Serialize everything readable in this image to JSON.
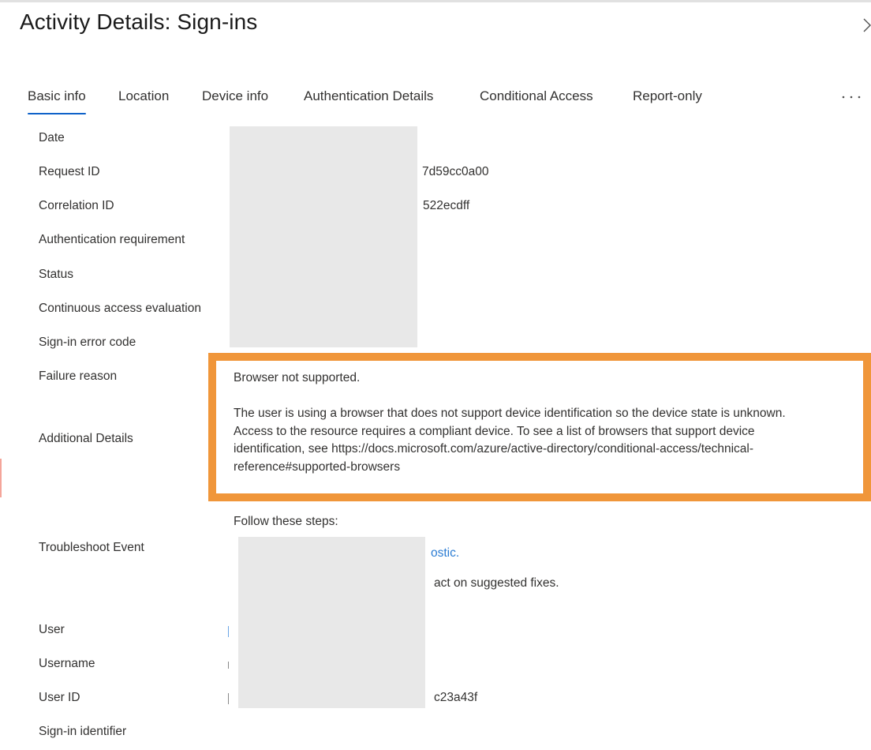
{
  "panel": {
    "title": "Activity Details: Sign-ins",
    "close_icon": "close-chevron-icon",
    "more_icon": "ellipsis-icon"
  },
  "tabs": [
    {
      "label": "Basic info",
      "active": true
    },
    {
      "label": "Location",
      "active": false
    },
    {
      "label": "Device info",
      "active": false
    },
    {
      "label": "Authentication Details",
      "active": false
    },
    {
      "label": "Conditional Access",
      "active": false
    },
    {
      "label": "Report-only",
      "active": false
    }
  ],
  "fields": {
    "date": {
      "label": "Date",
      "value": ""
    },
    "request_id": {
      "label": "Request ID",
      "value_visible_tail": "7d59cc0a00"
    },
    "correlation_id": {
      "label": "Correlation ID",
      "value_visible_tail": "522ecdff"
    },
    "authentication_requirement": {
      "label": "Authentication requirement",
      "value": ""
    },
    "status": {
      "label": "Status",
      "value": ""
    },
    "continuous_access_evaluation": {
      "label": "Continuous access evaluation",
      "value": ""
    },
    "sign_in_error_code": {
      "label": "Sign-in error code",
      "value": ""
    },
    "failure_reason": {
      "label": "Failure reason",
      "value": "Browser not supported."
    },
    "additional_details": {
      "label": "Additional Details",
      "lines": [
        "The user is using a browser that does not support device identification so the device state is unknown.",
        "Access to the resource requires a compliant device. To see a list of browsers that support device",
        "identification, see https://docs.microsoft.com/azure/active-directory/conditional-access/technical-",
        "reference#supported-browsers"
      ]
    },
    "troubleshoot_event": {
      "label": "Troubleshoot Event",
      "intro": "Follow these steps:",
      "step1_visible_tail": "ostic.",
      "step2_visible_tail": "act on suggested fixes."
    },
    "user": {
      "label": "User",
      "value": ""
    },
    "username": {
      "label": "Username",
      "value": ""
    },
    "user_id": {
      "label": "User ID",
      "value_visible_tail": "c23a43f"
    },
    "sign_in_identifier": {
      "label": "Sign-in identifier",
      "value": ""
    }
  },
  "colors": {
    "highlight_border": "#f0963a",
    "active_tab_underline": "#0f62c9",
    "link": "#2b7cd3",
    "redaction": "#e8e8e8"
  }
}
